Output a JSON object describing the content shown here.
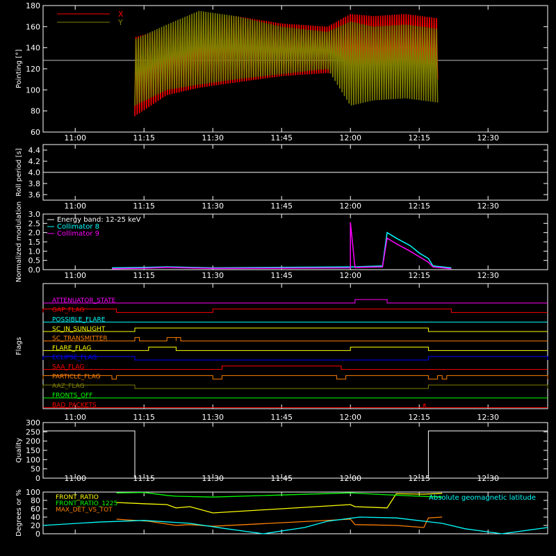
{
  "time_ticks": [
    "11:00",
    "11:15",
    "11:30",
    "11:45",
    "12:00",
    "12:15",
    "12:30"
  ],
  "colors": {
    "background": "#000000",
    "axes": "#ffffff",
    "x_pointing": "#ff0000",
    "y_pointing": "#808000",
    "cyan": "#00ffff",
    "magenta": "#ff00ff",
    "yellow": "#ffff00",
    "orange": "#ff8000",
    "red": "#ff0000",
    "blue": "#0000ff",
    "green": "#00ff00",
    "olive": "#808000"
  },
  "chart_data": [
    {
      "type": "line",
      "panel": "pointing",
      "ylabel": "Pointing [°]",
      "ylim": [
        60,
        180
      ],
      "yticks": [
        "60",
        "80",
        "100",
        "120",
        "140",
        "160",
        "180"
      ],
      "legend": [
        "X",
        "Y"
      ],
      "legend_placement": "top-left",
      "reference_line": 128,
      "data_span": [
        "11:13",
        "12:19"
      ],
      "series": [
        {
          "name": "X",
          "color": "#ff0000",
          "x": [
            "11:13",
            "11:20",
            "11:27",
            "11:35",
            "11:45",
            "11:55",
            "12:00",
            "12:05",
            "12:12",
            "12:19"
          ],
          "upper": [
            150,
            158,
            166,
            170,
            163,
            160,
            172,
            170,
            172,
            168
          ],
          "lower": [
            75,
            95,
            102,
            107,
            113,
            116,
            112,
            110,
            112,
            110
          ]
        },
        {
          "name": "Y",
          "color": "#808000",
          "x": [
            "11:13",
            "11:20",
            "11:27",
            "11:35",
            "11:45",
            "11:55",
            "12:00",
            "12:05",
            "12:12",
            "12:19"
          ],
          "upper": [
            148,
            162,
            175,
            170,
            160,
            155,
            165,
            160,
            162,
            158
          ],
          "lower": [
            85,
            100,
            105,
            110,
            115,
            120,
            85,
            90,
            92,
            88
          ]
        }
      ]
    },
    {
      "type": "line",
      "panel": "roll_period",
      "ylabel": "Roll period [s]",
      "ylim": [
        3.5,
        4.5
      ],
      "yticks": [
        "3.6",
        "3.8",
        "4.0",
        "4.2",
        "4.4"
      ],
      "series": [
        {
          "name": "",
          "color": "#ffffff",
          "x": [
            "10:53",
            "12:43"
          ],
          "y": [
            4.0,
            4.0
          ]
        }
      ]
    },
    {
      "type": "line",
      "panel": "modulation",
      "ylabel": "Normalized modulation",
      "ylim": [
        0,
        3.0
      ],
      "yticks": [
        "0.0",
        "0.5",
        "1.0",
        "1.5",
        "2.0",
        "2.5",
        "3.0"
      ],
      "legend": [
        "Energy band: 12-25 keV",
        "Collimator 8",
        "Collimator 9"
      ],
      "legend_placement": "top-left",
      "series": [
        {
          "name": "Collimator 8",
          "color": "#00ffff",
          "x": [
            "11:08",
            "11:15",
            "11:20",
            "11:30",
            "12:01",
            "12:07",
            "12:08",
            "12:10",
            "12:13",
            "12:15",
            "12:17",
            "12:18",
            "12:22"
          ],
          "y": [
            0.1,
            0.12,
            0.15,
            0.1,
            0.15,
            0.2,
            2.0,
            1.7,
            1.3,
            0.9,
            0.6,
            0.2,
            0.1
          ]
        },
        {
          "name": "Collimator 9",
          "color": "#ff00ff",
          "x": [
            "11:08",
            "11:15",
            "11:20",
            "11:30",
            "12:00",
            "12:00",
            "12:01",
            "12:07",
            "12:08",
            "12:10",
            "12:13",
            "12:15",
            "12:17",
            "12:18",
            "12:22"
          ],
          "y": [
            0.05,
            0.08,
            0.12,
            0.07,
            0.1,
            2.55,
            0.12,
            0.15,
            1.7,
            1.4,
            1.0,
            0.7,
            0.4,
            0.15,
            0.05
          ]
        }
      ]
    },
    {
      "type": "line",
      "panel": "flags",
      "ylabel": "Flags",
      "flags": [
        {
          "label": "ATTENUATOR_STATE",
          "color": "#ff00ff",
          "high": [
            [
              "12:01",
              "12:08"
            ]
          ]
        },
        {
          "label": "GAP_FLAG",
          "color": "#ff0000",
          "high": [
            [
              "10:53",
              "11:09"
            ],
            [
              "11:30",
              "12:22"
            ]
          ]
        },
        {
          "label": "POSSIBLE_FLARE",
          "color": "#00ffff",
          "high": []
        },
        {
          "label": "SC_IN_SUNLIGHT",
          "color": "#ffff00",
          "high": [
            [
              "11:13",
              "12:17"
            ]
          ]
        },
        {
          "label": "SC_TRANSMITTER",
          "color": "#ff8000",
          "high": [
            [
              "11:13",
              "11:14"
            ],
            [
              "11:20",
              "11:22"
            ],
            [
              "11:22",
              "11:23"
            ]
          ]
        },
        {
          "label": "FLARE_FLAG",
          "color": "#ffff00",
          "high": [
            [
              "11:16",
              "11:22"
            ],
            [
              "12:00",
              "12:17"
            ]
          ]
        },
        {
          "label": "ECLIPSE_FLAG",
          "color": "#0000ff",
          "high": [
            [
              "10:53",
              "11:13"
            ],
            [
              "12:17",
              "12:43"
            ]
          ]
        },
        {
          "label": "SAA_FLAG",
          "color": "#ff0000",
          "high": [
            [
              "11:32",
              "11:58"
            ]
          ]
        },
        {
          "label": "PARTICLE_FLAG",
          "color": "#ff8000",
          "high": [
            [
              "10:53",
              "11:08"
            ],
            [
              "11:09",
              "11:30"
            ],
            [
              "11:32",
              "11:57"
            ],
            [
              "11:59",
              "12:17"
            ],
            [
              "12:19",
              "12:20"
            ],
            [
              "12:21",
              "12:43"
            ]
          ]
        },
        {
          "label": "AAZ_FLAG",
          "color": "#808000",
          "high": [
            [
              "10:53",
              "11:13"
            ],
            [
              "12:17",
              "12:43"
            ]
          ]
        },
        {
          "label": "FRONTS_OFF",
          "color": "#00ff00",
          "high": []
        },
        {
          "label": "BAD_PACKETS",
          "color": "#ff0000",
          "high": [
            [
              "12:16",
              "12:16"
            ]
          ]
        }
      ]
    },
    {
      "type": "line",
      "panel": "quality",
      "ylabel": "Quality",
      "ylim": [
        0,
        300
      ],
      "yticks": [
        "0",
        "50",
        "100",
        "150",
        "200",
        "250",
        "300"
      ],
      "series": [
        {
          "name": "",
          "color": "#ffffff",
          "x": [
            "10:53",
            "11:13",
            "11:13",
            "12:17",
            "12:17",
            "12:43"
          ],
          "y": [
            255,
            255,
            0,
            0,
            255,
            255
          ]
        }
      ]
    },
    {
      "type": "line",
      "panel": "ratios",
      "ylabel": "Degrees or %",
      "ylim": [
        0,
        100
      ],
      "yticks": [
        "0",
        "20",
        "40",
        "60",
        "80",
        "100"
      ],
      "legend": [
        "FRONT_RATIO",
        "FRONT_RATIO_1225",
        "MAX_DET_VS_TOT"
      ],
      "legend_placement": "top-left",
      "annotation": "Absolute geomagnetic latitude",
      "series": [
        {
          "name": "FRONT_RATIO",
          "color": "#ffff00",
          "x": [
            "11:09",
            "11:15",
            "11:20",
            "11:22",
            "11:25",
            "11:30",
            "12:00",
            "12:01",
            "12:08",
            "12:10",
            "12:16",
            "12:20"
          ],
          "y": [
            75,
            72,
            70,
            62,
            65,
            50,
            70,
            65,
            62,
            96,
            95,
            97
          ]
        },
        {
          "name": "FRONT_RATIO_1225",
          "color": "#00ff00",
          "x": [
            "11:09",
            "11:15",
            "11:20",
            "11:22",
            "11:30",
            "12:00",
            "12:07",
            "12:15",
            "12:20"
          ],
          "y": [
            98,
            99,
            92,
            90,
            88,
            98,
            94,
            90,
            88
          ]
        },
        {
          "name": "MAX_DET_VS_TOT",
          "color": "#ff8000",
          "x": [
            "11:09",
            "11:16",
            "11:22",
            "11:25",
            "11:30",
            "12:00",
            "12:01",
            "12:10",
            "12:16",
            "12:17",
            "12:20"
          ],
          "y": [
            35,
            30,
            20,
            22,
            18,
            35,
            22,
            20,
            15,
            38,
            40
          ]
        },
        {
          "name": "Absolute geomagnetic latitude",
          "color": "#00ffff",
          "x": [
            "10:53",
            "11:05",
            "11:15",
            "11:25",
            "11:33",
            "11:41",
            "11:50",
            "11:55",
            "12:02",
            "12:10",
            "12:20",
            "12:25",
            "12:33",
            "12:43"
          ],
          "y": [
            20,
            28,
            32,
            25,
            12,
            0,
            15,
            30,
            40,
            38,
            25,
            12,
            0,
            15
          ]
        }
      ]
    }
  ]
}
